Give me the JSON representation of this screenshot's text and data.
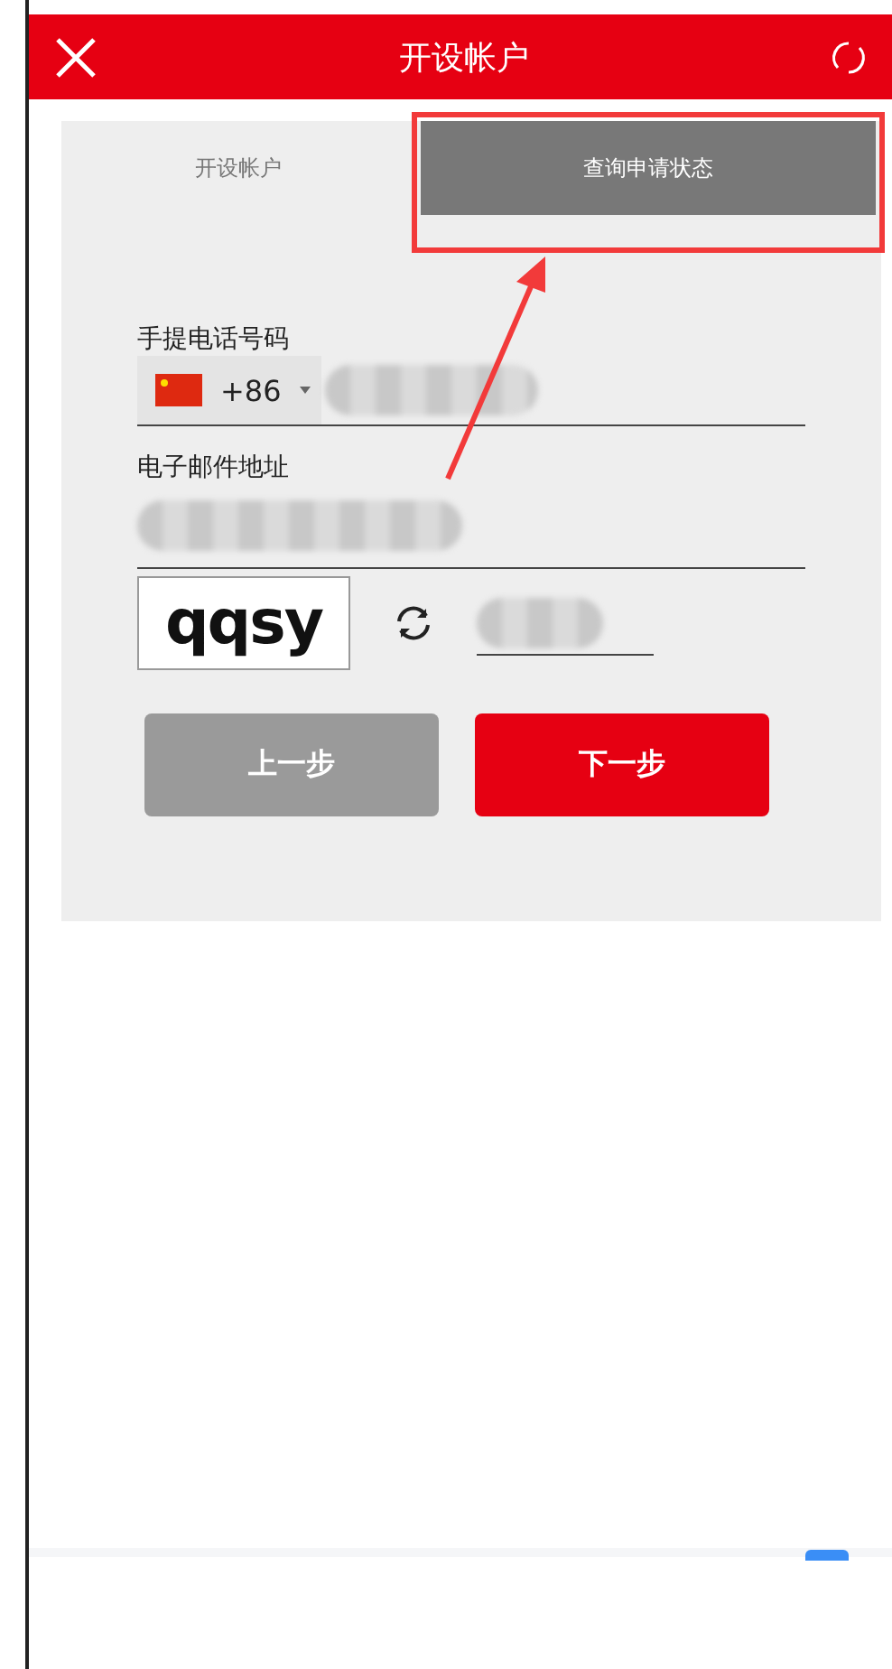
{
  "header": {
    "title": "开设帐户"
  },
  "tabs": [
    {
      "label": "开设帐户",
      "selected": false
    },
    {
      "label": "查询申请状态",
      "selected": true
    }
  ],
  "phone_field": {
    "label": "手提电话号码",
    "country_code": "+86"
  },
  "email_field": {
    "label": "电子邮件地址"
  },
  "captcha": {
    "text": "qqsy"
  },
  "buttons": [
    {
      "label": "上一步",
      "kind": "secondary"
    },
    {
      "label": "下一步",
      "kind": "primary"
    }
  ]
}
